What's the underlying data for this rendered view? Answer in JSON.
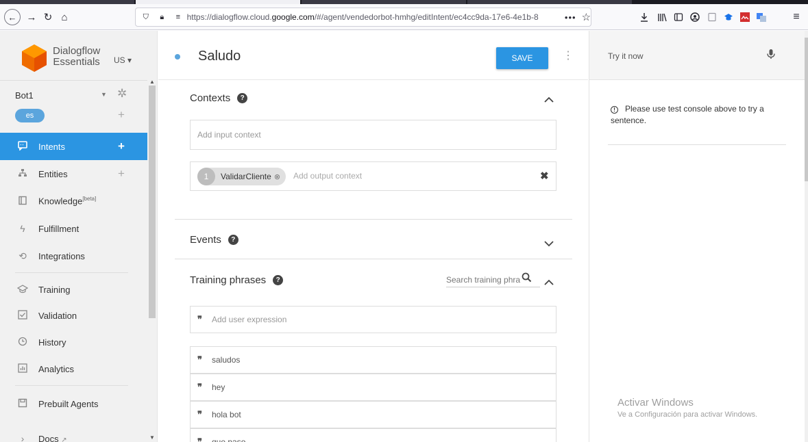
{
  "browser": {
    "url_prefix": "https://dialogflow.cloud.",
    "url_domain": "google.com",
    "url_suffix": "/#/agent/vendedorbot-hmhg/editIntent/ec4cc9da-17e6-4e1b-8",
    "more": "•••"
  },
  "brand": {
    "line1": "Dialogflow",
    "line2": "Essentials",
    "region": "US ▾",
    "logo_color": "#ef6c00"
  },
  "agent": {
    "name": "Bot1",
    "language": "es"
  },
  "nav": {
    "intents": "Intents",
    "entities": "Entities",
    "knowledge": "Knowledge",
    "knowledge_badge": "[beta]",
    "fulfillment": "Fulfillment",
    "integrations": "Integrations",
    "training": "Training",
    "validation": "Validation",
    "history": "History",
    "analytics": "Analytics",
    "prebuilt": "Prebuilt Agents",
    "docs": "Docs"
  },
  "intent": {
    "title": "Saludo",
    "save_label": "SAVE"
  },
  "contexts": {
    "title": "Contexts",
    "input_placeholder": "Add input context",
    "output_chip_num": "1",
    "output_chip_name": "ValidarCliente",
    "output_placeholder": "Add output context"
  },
  "events": {
    "title": "Events"
  },
  "training_phrases": {
    "title": "Training phrases",
    "search_placeholder": "Search training phra",
    "add_placeholder": "Add user expression",
    "items": [
      "saludos",
      "hey",
      "hola bot",
      "que paso"
    ]
  },
  "try_panel": {
    "label": "Try it now",
    "info": "Please use test console above to try a sentence."
  },
  "watermark": {
    "line1": "Activar Windows",
    "line2": "Ve a Configuración para activar Windows."
  },
  "colors": {
    "accent": "#2b95e2",
    "chip": "#5ba5dd"
  }
}
